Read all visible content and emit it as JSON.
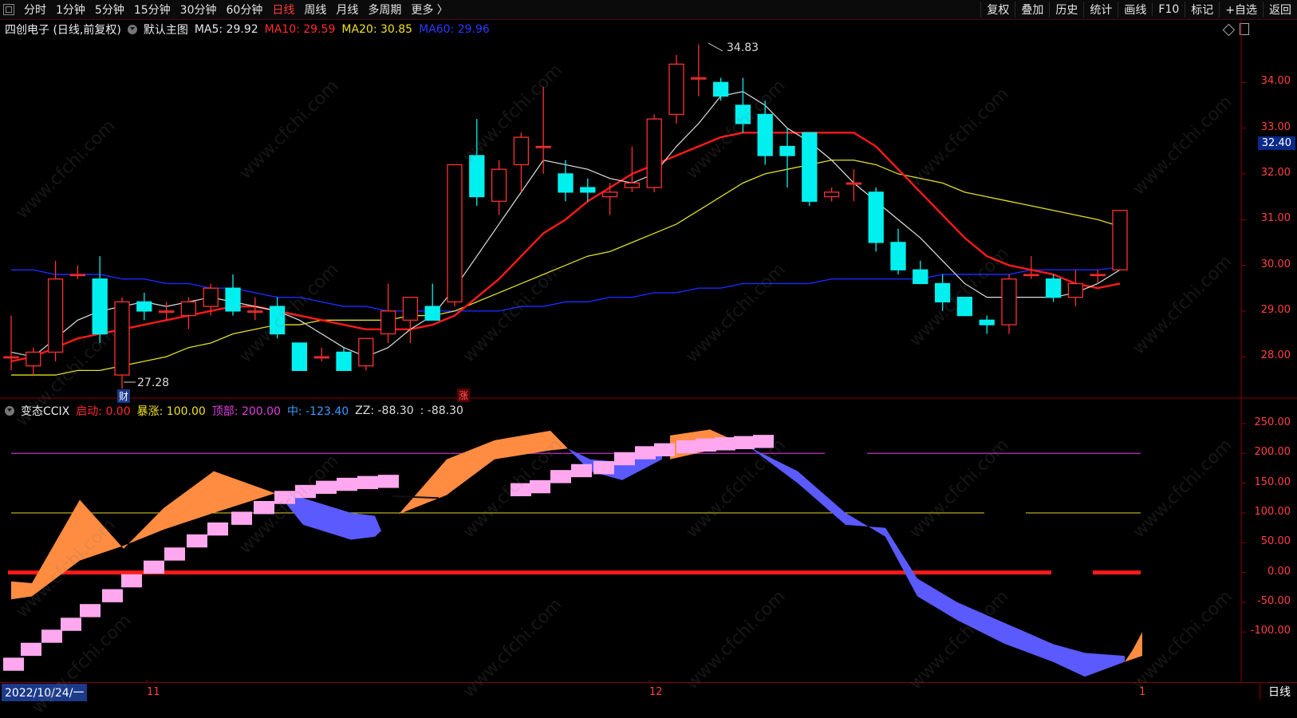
{
  "toolbar": {
    "periods": [
      {
        "label": "分时",
        "active": false
      },
      {
        "label": "1分钟",
        "active": false
      },
      {
        "label": "5分钟",
        "active": false
      },
      {
        "label": "15分钟",
        "active": false
      },
      {
        "label": "30分钟",
        "active": false
      },
      {
        "label": "60分钟",
        "active": false
      },
      {
        "label": "日线",
        "active": true
      },
      {
        "label": "周线",
        "active": false
      },
      {
        "label": "月线",
        "active": false
      },
      {
        "label": "多周期",
        "active": false
      },
      {
        "label": "更多 〉",
        "active": false
      }
    ],
    "tools": [
      "复权",
      "叠加",
      "历史",
      "统计",
      "画线",
      "F10",
      "标记",
      "+自选",
      "返回"
    ]
  },
  "main_header": {
    "stock": "四创电子 (日线,前复权)",
    "template": "默认主图",
    "ma5": "MA5: 29.92",
    "ma10": "MA10: 29.59",
    "ma20": "MA20: 30.85",
    "ma60": "MA60: 29.96"
  },
  "sub_header": {
    "name": "变态CCIX",
    "start": "启动: 0.00",
    "surge": "暴涨: 100.00",
    "top": "顶部: 200.00",
    "mid": "中: -123.40",
    "zz": "ZZ: -88.30",
    "extra": ": -88.30"
  },
  "price_axis": [
    "34.00",
    "33.00",
    "32.00",
    "31.00",
    "30.00",
    "29.00",
    "28.00"
  ],
  "current_price": "32.40",
  "cci_axis": [
    "250.00",
    "200.00",
    "150.00",
    "100.00",
    "50.00",
    "0.00",
    "-50.00",
    "-100.00"
  ],
  "annotations": {
    "high": "34.83",
    "low": "27.28",
    "badge_cai": "财",
    "badge_zhang": "涨"
  },
  "time_axis": {
    "start_date": "2022/10/24/一",
    "ticks": [
      "11",
      "12",
      "1"
    ],
    "period": "日线"
  },
  "watermark": "www.cfchi.com",
  "colors": {
    "up": "#ff3030",
    "down": "#00f0f0",
    "ma5": "#e0e0e0",
    "ma10": "#ff1a1a",
    "ma20": "#e0e020",
    "ma60": "#1a2aff"
  },
  "chart_data": {
    "type": "candlestick",
    "candles": [
      {
        "o": 28.0,
        "h": 28.9,
        "l": 27.7,
        "c": 28.0
      },
      {
        "o": 27.8,
        "h": 28.2,
        "l": 27.6,
        "c": 28.1
      },
      {
        "o": 28.1,
        "h": 30.1,
        "l": 27.9,
        "c": 29.7
      },
      {
        "o": 29.8,
        "h": 30.0,
        "l": 29.7,
        "c": 29.8
      },
      {
        "o": 29.7,
        "h": 30.2,
        "l": 28.3,
        "c": 28.5
      },
      {
        "o": 27.6,
        "h": 29.3,
        "l": 27.3,
        "c": 29.2
      },
      {
        "o": 29.2,
        "h": 29.4,
        "l": 28.8,
        "c": 29.0
      },
      {
        "o": 29.0,
        "h": 29.2,
        "l": 28.8,
        "c": 29.0
      },
      {
        "o": 28.9,
        "h": 29.3,
        "l": 28.6,
        "c": 29.2
      },
      {
        "o": 29.1,
        "h": 29.6,
        "l": 28.9,
        "c": 29.5
      },
      {
        "o": 29.5,
        "h": 29.8,
        "l": 28.9,
        "c": 29.0
      },
      {
        "o": 29.0,
        "h": 29.3,
        "l": 28.8,
        "c": 29.0
      },
      {
        "o": 29.1,
        "h": 29.3,
        "l": 28.4,
        "c": 28.5
      },
      {
        "o": 28.3,
        "h": 28.3,
        "l": 27.7,
        "c": 27.7
      },
      {
        "o": 28.0,
        "h": 28.2,
        "l": 27.9,
        "c": 28.0
      },
      {
        "o": 28.1,
        "h": 28.2,
        "l": 27.7,
        "c": 27.7
      },
      {
        "o": 27.8,
        "h": 28.4,
        "l": 27.7,
        "c": 28.4
      },
      {
        "o": 28.5,
        "h": 29.6,
        "l": 28.3,
        "c": 29.0
      },
      {
        "o": 28.8,
        "h": 29.3,
        "l": 28.3,
        "c": 29.3
      },
      {
        "o": 29.1,
        "h": 29.6,
        "l": 28.8,
        "c": 28.8
      },
      {
        "o": 29.2,
        "h": 32.2,
        "l": 29.1,
        "c": 32.2
      },
      {
        "o": 32.4,
        "h": 33.2,
        "l": 31.3,
        "c": 31.5
      },
      {
        "o": 31.4,
        "h": 32.3,
        "l": 31.1,
        "c": 32.1
      },
      {
        "o": 32.2,
        "h": 32.9,
        "l": 31.6,
        "c": 32.8
      },
      {
        "o": 32.6,
        "h": 33.9,
        "l": 32.0,
        "c": 32.6
      },
      {
        "o": 32.0,
        "h": 32.3,
        "l": 31.4,
        "c": 31.6
      },
      {
        "o": 31.7,
        "h": 31.9,
        "l": 31.4,
        "c": 31.6
      },
      {
        "o": 31.5,
        "h": 31.8,
        "l": 31.1,
        "c": 31.6
      },
      {
        "o": 31.7,
        "h": 32.6,
        "l": 31.6,
        "c": 31.8
      },
      {
        "o": 31.7,
        "h": 33.3,
        "l": 31.6,
        "c": 33.2
      },
      {
        "o": 33.3,
        "h": 34.6,
        "l": 33.1,
        "c": 34.4
      },
      {
        "o": 34.1,
        "h": 34.83,
        "l": 33.7,
        "c": 34.1
      },
      {
        "o": 34.0,
        "h": 34.1,
        "l": 33.6,
        "c": 33.7
      },
      {
        "o": 33.5,
        "h": 34.1,
        "l": 32.9,
        "c": 33.1
      },
      {
        "o": 33.3,
        "h": 33.6,
        "l": 32.2,
        "c": 32.4
      },
      {
        "o": 32.6,
        "h": 33.0,
        "l": 31.7,
        "c": 32.4
      },
      {
        "o": 32.9,
        "h": 32.9,
        "l": 31.3,
        "c": 31.4
      },
      {
        "o": 31.5,
        "h": 31.7,
        "l": 31.4,
        "c": 31.6
      },
      {
        "o": 31.8,
        "h": 32.1,
        "l": 31.4,
        "c": 31.8
      },
      {
        "o": 31.6,
        "h": 31.7,
        "l": 30.3,
        "c": 30.5
      },
      {
        "o": 30.5,
        "h": 30.8,
        "l": 29.8,
        "c": 29.9
      },
      {
        "o": 29.9,
        "h": 30.1,
        "l": 29.6,
        "c": 29.6
      },
      {
        "o": 29.6,
        "h": 29.8,
        "l": 29.0,
        "c": 29.2
      },
      {
        "o": 29.3,
        "h": 29.3,
        "l": 28.9,
        "c": 28.9
      },
      {
        "o": 28.8,
        "h": 28.9,
        "l": 28.5,
        "c": 28.7
      },
      {
        "o": 28.7,
        "h": 29.8,
        "l": 28.5,
        "c": 29.7
      },
      {
        "o": 29.8,
        "h": 30.2,
        "l": 29.7,
        "c": 29.8
      },
      {
        "o": 29.7,
        "h": 29.8,
        "l": 29.2,
        "c": 29.3
      },
      {
        "o": 29.3,
        "h": 29.9,
        "l": 29.1,
        "c": 29.6
      },
      {
        "o": 29.8,
        "h": 29.9,
        "l": 29.6,
        "c": 29.8
      },
      {
        "o": 29.9,
        "h": 31.2,
        "l": 29.9,
        "c": 31.2
      }
    ],
    "ma5": [
      28.1,
      28.0,
      28.4,
      28.8,
      29.0,
      29.1,
      29.2,
      29.1,
      29.2,
      29.3,
      29.2,
      29.1,
      29.0,
      28.8,
      28.5,
      28.2,
      28.0,
      28.2,
      28.6,
      28.9,
      29.5,
      30.2,
      30.9,
      31.6,
      32.3,
      32.2,
      32.1,
      31.9,
      31.8,
      32.0,
      32.6,
      33.1,
      33.7,
      33.8,
      33.5,
      33.0,
      32.7,
      32.3,
      31.8,
      31.4,
      31.0,
      30.6,
      30.1,
      29.6,
      29.3,
      29.3,
      29.3,
      29.3,
      29.4,
      29.6,
      29.9
    ],
    "ma10": [
      27.9,
      28.0,
      28.2,
      28.4,
      28.5,
      28.6,
      28.7,
      28.8,
      28.9,
      29.0,
      29.1,
      29.1,
      29.0,
      28.9,
      28.8,
      28.7,
      28.6,
      28.6,
      28.6,
      28.7,
      28.9,
      29.3,
      29.7,
      30.2,
      30.7,
      31.0,
      31.4,
      31.7,
      32.0,
      32.2,
      32.4,
      32.6,
      32.8,
      32.9,
      32.9,
      32.9,
      32.9,
      32.9,
      32.9,
      32.6,
      32.1,
      31.6,
      31.1,
      30.6,
      30.2,
      30.0,
      29.9,
      29.8,
      29.6,
      29.5,
      29.6
    ],
    "ma20": [
      27.6,
      27.6,
      27.6,
      27.7,
      27.7,
      27.8,
      27.9,
      28.0,
      28.2,
      28.3,
      28.5,
      28.6,
      28.7,
      28.7,
      28.8,
      28.8,
      28.8,
      28.8,
      28.9,
      28.9,
      29.0,
      29.2,
      29.4,
      29.6,
      29.8,
      30.0,
      30.2,
      30.3,
      30.5,
      30.7,
      30.9,
      31.2,
      31.5,
      31.8,
      32.0,
      32.1,
      32.2,
      32.3,
      32.3,
      32.2,
      32.0,
      31.9,
      31.8,
      31.6,
      31.5,
      31.4,
      31.3,
      31.2,
      31.1,
      31.0,
      30.85
    ],
    "ma60": [
      29.9,
      29.9,
      29.8,
      29.8,
      29.8,
      29.7,
      29.7,
      29.6,
      29.6,
      29.5,
      29.5,
      29.4,
      29.3,
      29.3,
      29.2,
      29.1,
      29.1,
      29.0,
      29.0,
      29.0,
      29.0,
      29.0,
      29.0,
      29.1,
      29.1,
      29.2,
      29.2,
      29.3,
      29.3,
      29.4,
      29.4,
      29.5,
      29.5,
      29.6,
      29.6,
      29.6,
      29.6,
      29.7,
      29.7,
      29.7,
      29.7,
      29.7,
      29.8,
      29.8,
      29.8,
      29.8,
      29.9,
      29.9,
      29.9,
      29.9,
      29.96
    ],
    "price_range": [
      27.2,
      35.0
    ],
    "cci_range": [
      -180,
      270
    ]
  }
}
